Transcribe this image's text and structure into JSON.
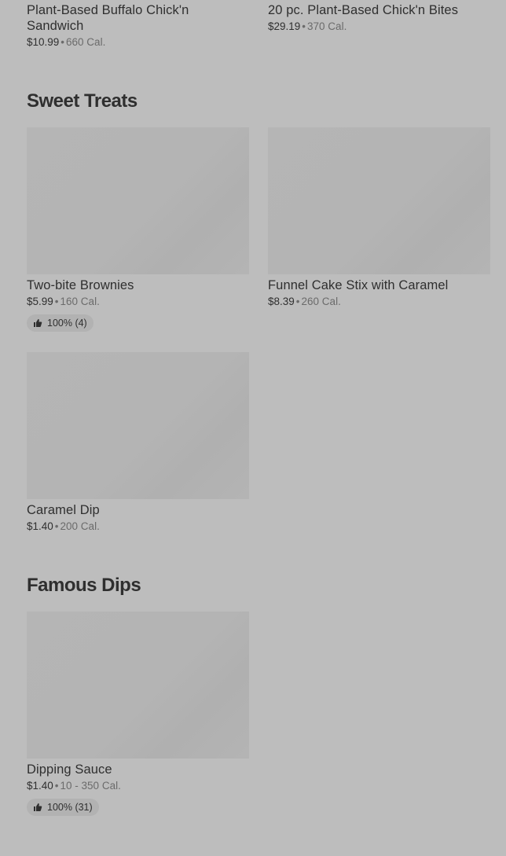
{
  "top_items": [
    {
      "name": "Plant-Based Buffalo Chick'n Sandwich",
      "price": "$10.99",
      "calories": "660 Cal."
    },
    {
      "name": "20 pc. Plant-Based Chick'n Bites",
      "price": "$29.19",
      "calories": "370 Cal."
    }
  ],
  "sweet_treats": {
    "title": "Sweet Treats",
    "items": [
      {
        "name": "Two-bite Brownies",
        "price": "$5.99",
        "calories": "160 Cal.",
        "rating": "100% (4)"
      },
      {
        "name": "Funnel Cake Stix with Caramel",
        "price": "$8.39",
        "calories": "260 Cal."
      },
      {
        "name": "Caramel Dip",
        "price": "$1.40",
        "calories": "200 Cal."
      }
    ]
  },
  "famous_dips": {
    "title": "Famous Dips",
    "items": [
      {
        "name": "Dipping Sauce",
        "price": "$1.40",
        "calories": "10 - 350 Cal.",
        "rating": "100% (31)"
      }
    ]
  },
  "separator": "•",
  "icons": {
    "rating": "thumbs-up-icon"
  },
  "colors": {
    "overlay_background": "#bdbdbd",
    "text": "#2f2f2f",
    "muted_text": "#6b6b6b"
  }
}
